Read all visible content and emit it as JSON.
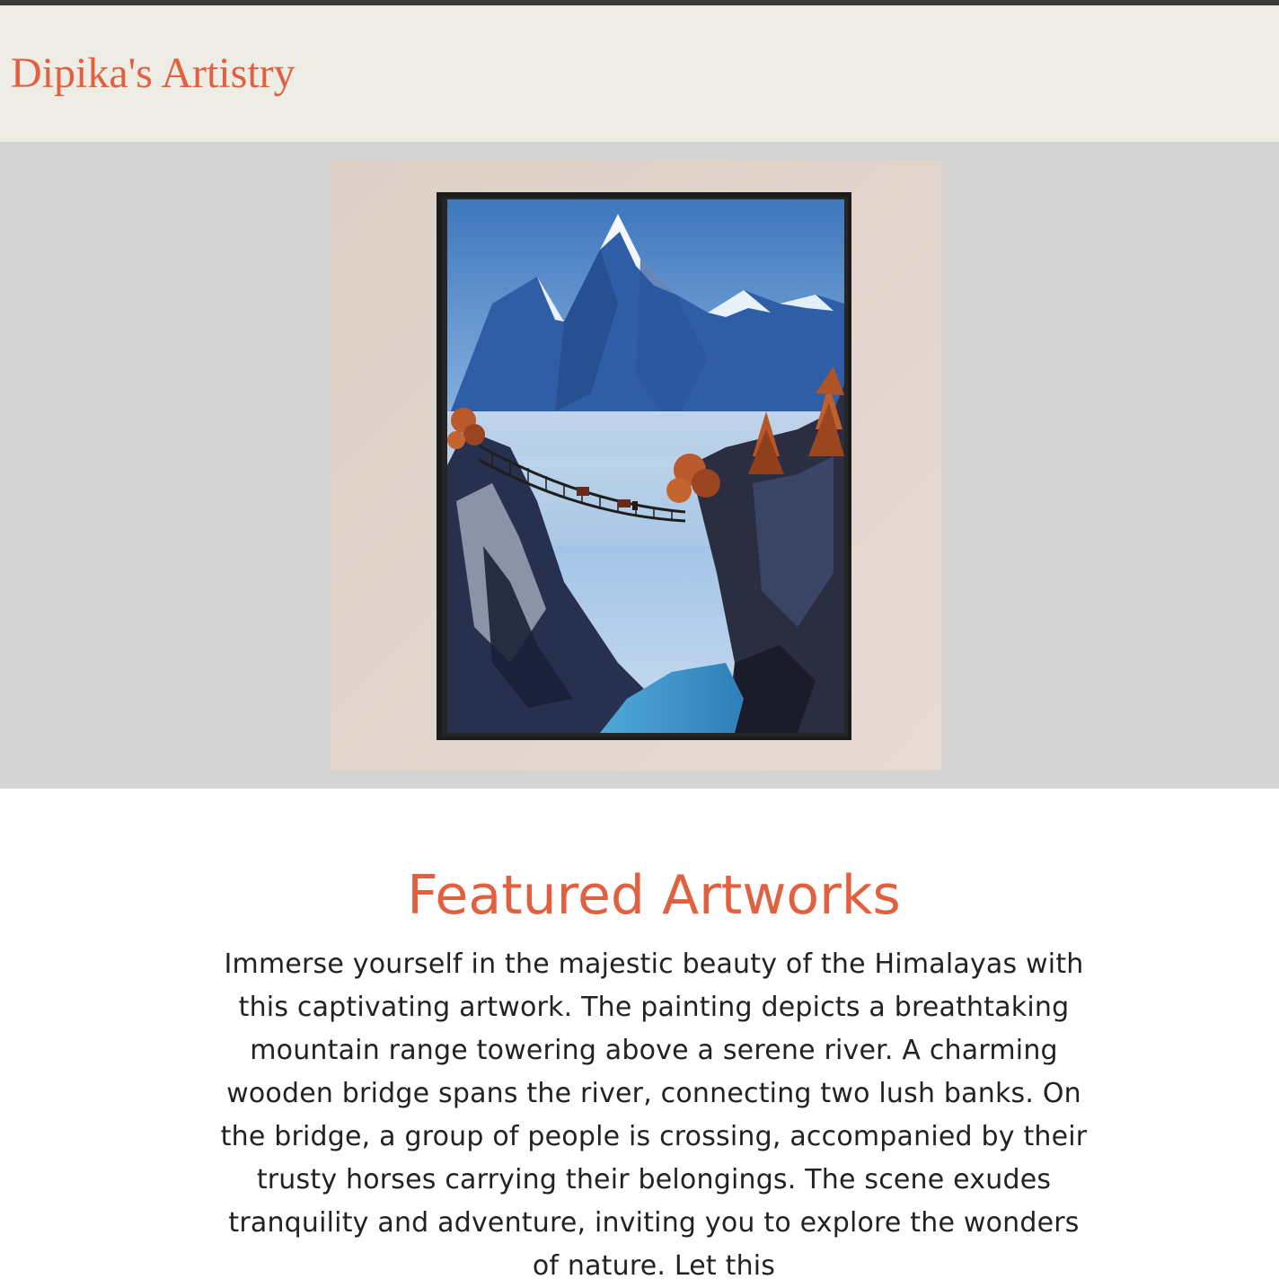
{
  "header": {
    "brand": "Dipika's Artistry"
  },
  "hero": {
    "image_subject": "mountain-bridge-painting"
  },
  "featured": {
    "title": "Featured Artworks",
    "description": "Immerse yourself in the majestic beauty of the Himalayas with this captivating artwork. The painting depicts a breathtaking mountain range towering above a serene river. A charming wooden bridge spans the river, connecting two lush banks. On the bridge, a group of people is crossing, accompanied by their trusty horses carrying their belongings. The scene exudes tranquility and adventure, inviting you to explore the wonders of nature. Let this"
  },
  "colors": {
    "accent": "#e2603f",
    "header_bg": "#eeede5",
    "hero_bg": "#d3d4d3",
    "topbar": "#3a3a3a",
    "text": "#222222"
  }
}
